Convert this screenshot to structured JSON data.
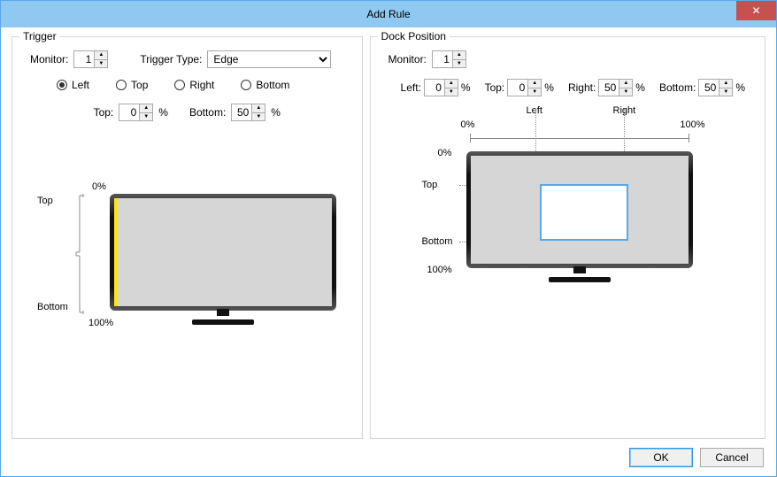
{
  "window": {
    "title": "Add Rule"
  },
  "trigger": {
    "legend": "Trigger",
    "monitor_label": "Monitor:",
    "monitor_value": "1",
    "type_label": "Trigger Type:",
    "type_value": "Edge",
    "edges": {
      "left": "Left",
      "top": "Top",
      "right": "Right",
      "bottom": "Bottom",
      "selected": "left"
    },
    "top_label": "Top:",
    "top_value": "0",
    "bottom_label": "Bottom:",
    "bottom_value": "50",
    "diag": {
      "zero": "0%",
      "hundred": "100%",
      "top": "Top",
      "bottom": "Bottom"
    }
  },
  "dock": {
    "legend": "Dock Position",
    "monitor_label": "Monitor:",
    "monitor_value": "1",
    "left_label": "Left:",
    "left_value": "0",
    "top_label": "Top:",
    "top_value": "0",
    "right_label": "Right:",
    "right_value": "50",
    "bottom_label": "Bottom:",
    "bottom_value": "50",
    "diag": {
      "zero": "0%",
      "hundred": "100%",
      "left": "Left",
      "right": "Right",
      "top": "Top",
      "bottom": "Bottom"
    }
  },
  "buttons": {
    "ok": "OK",
    "cancel": "Cancel"
  },
  "pct": "%"
}
